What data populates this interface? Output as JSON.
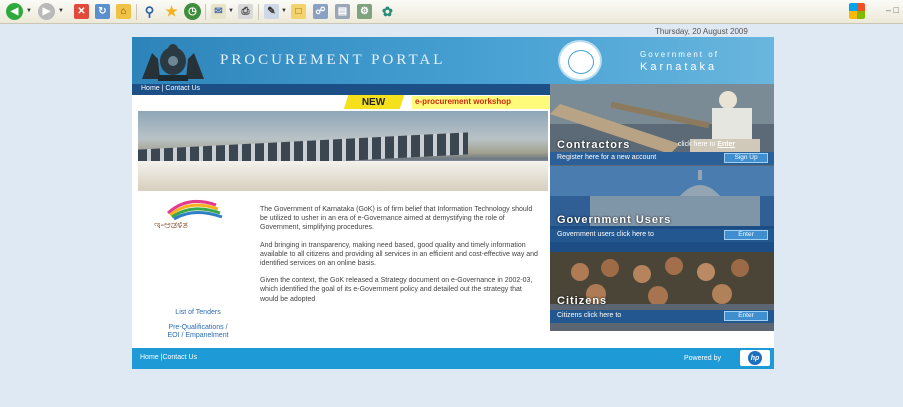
{
  "browser": {
    "toolbar_icons": [
      "back-icon",
      "forward-icon",
      "stop-icon",
      "refresh-icon",
      "home-icon",
      "search-icon",
      "favorites-icon",
      "history-icon",
      "mail-icon",
      "print-icon",
      "edit-icon",
      "folder-icon",
      "messenger-icon",
      "research-icon",
      "tools-icon"
    ]
  },
  "page": {
    "date": "Thursday, 20 August 2009"
  },
  "header": {
    "title": "PROCUREMENT PORTAL",
    "gov_line1": "Government of",
    "gov_line2": "Karnataka"
  },
  "nav": {
    "home": "Home",
    "separator": " | ",
    "contact": "Contact Us"
  },
  "news": {
    "badge": "NEW",
    "ticker": "e-procurement workshop"
  },
  "left_logo": {
    "text": "ಇ-ಆಡಳಿತ"
  },
  "body": {
    "paragraphs": [
      "The Government of Karnataka (GoK) is of firm belief that Information Technology should be utilized to usher in an era of e-Governance aimed at demystifying the role of Government, simplifying procedures.",
      "And bringing in transparency, making need based, good quality and timely information available to all citizens and providing all services in an efficient and cost-effective way and identified services on an online basis.",
      "Given the context, the GoK released a Strategy document on e-Governance in 2002-03, which identified the goal of its e-Government policy and detailed out the strategy that would be adopted"
    ]
  },
  "left_links": {
    "tenders": "List of Tenders",
    "prequal_line1": "Pre-Qualifications /",
    "prequal_line2": "EOI / Empanelment"
  },
  "contractors": {
    "title": "Contractors",
    "click_prefix": "click here to ",
    "click_link": "Enter",
    "bar_text": "Register here for a new account",
    "button": "Sign Up"
  },
  "gov_users": {
    "title": "Government Users",
    "bar_text": "Government users click here to",
    "button": "Enter"
  },
  "citizens": {
    "title": "Citizens",
    "bar_text": "Citizens click here to",
    "button": "Enter"
  },
  "footer": {
    "home": "Home",
    "separator": " |",
    "contact": "Contact Us",
    "powered_by": "Powered by",
    "hp": "hp"
  },
  "colors": {
    "header_blue": "#2c84ba",
    "nav_blue": "#1c4f86",
    "footer_blue": "#1e9ad6",
    "news_red": "#d02a12",
    "news_badge": "#f4e11b",
    "link_blue": "#2a6bb2"
  }
}
